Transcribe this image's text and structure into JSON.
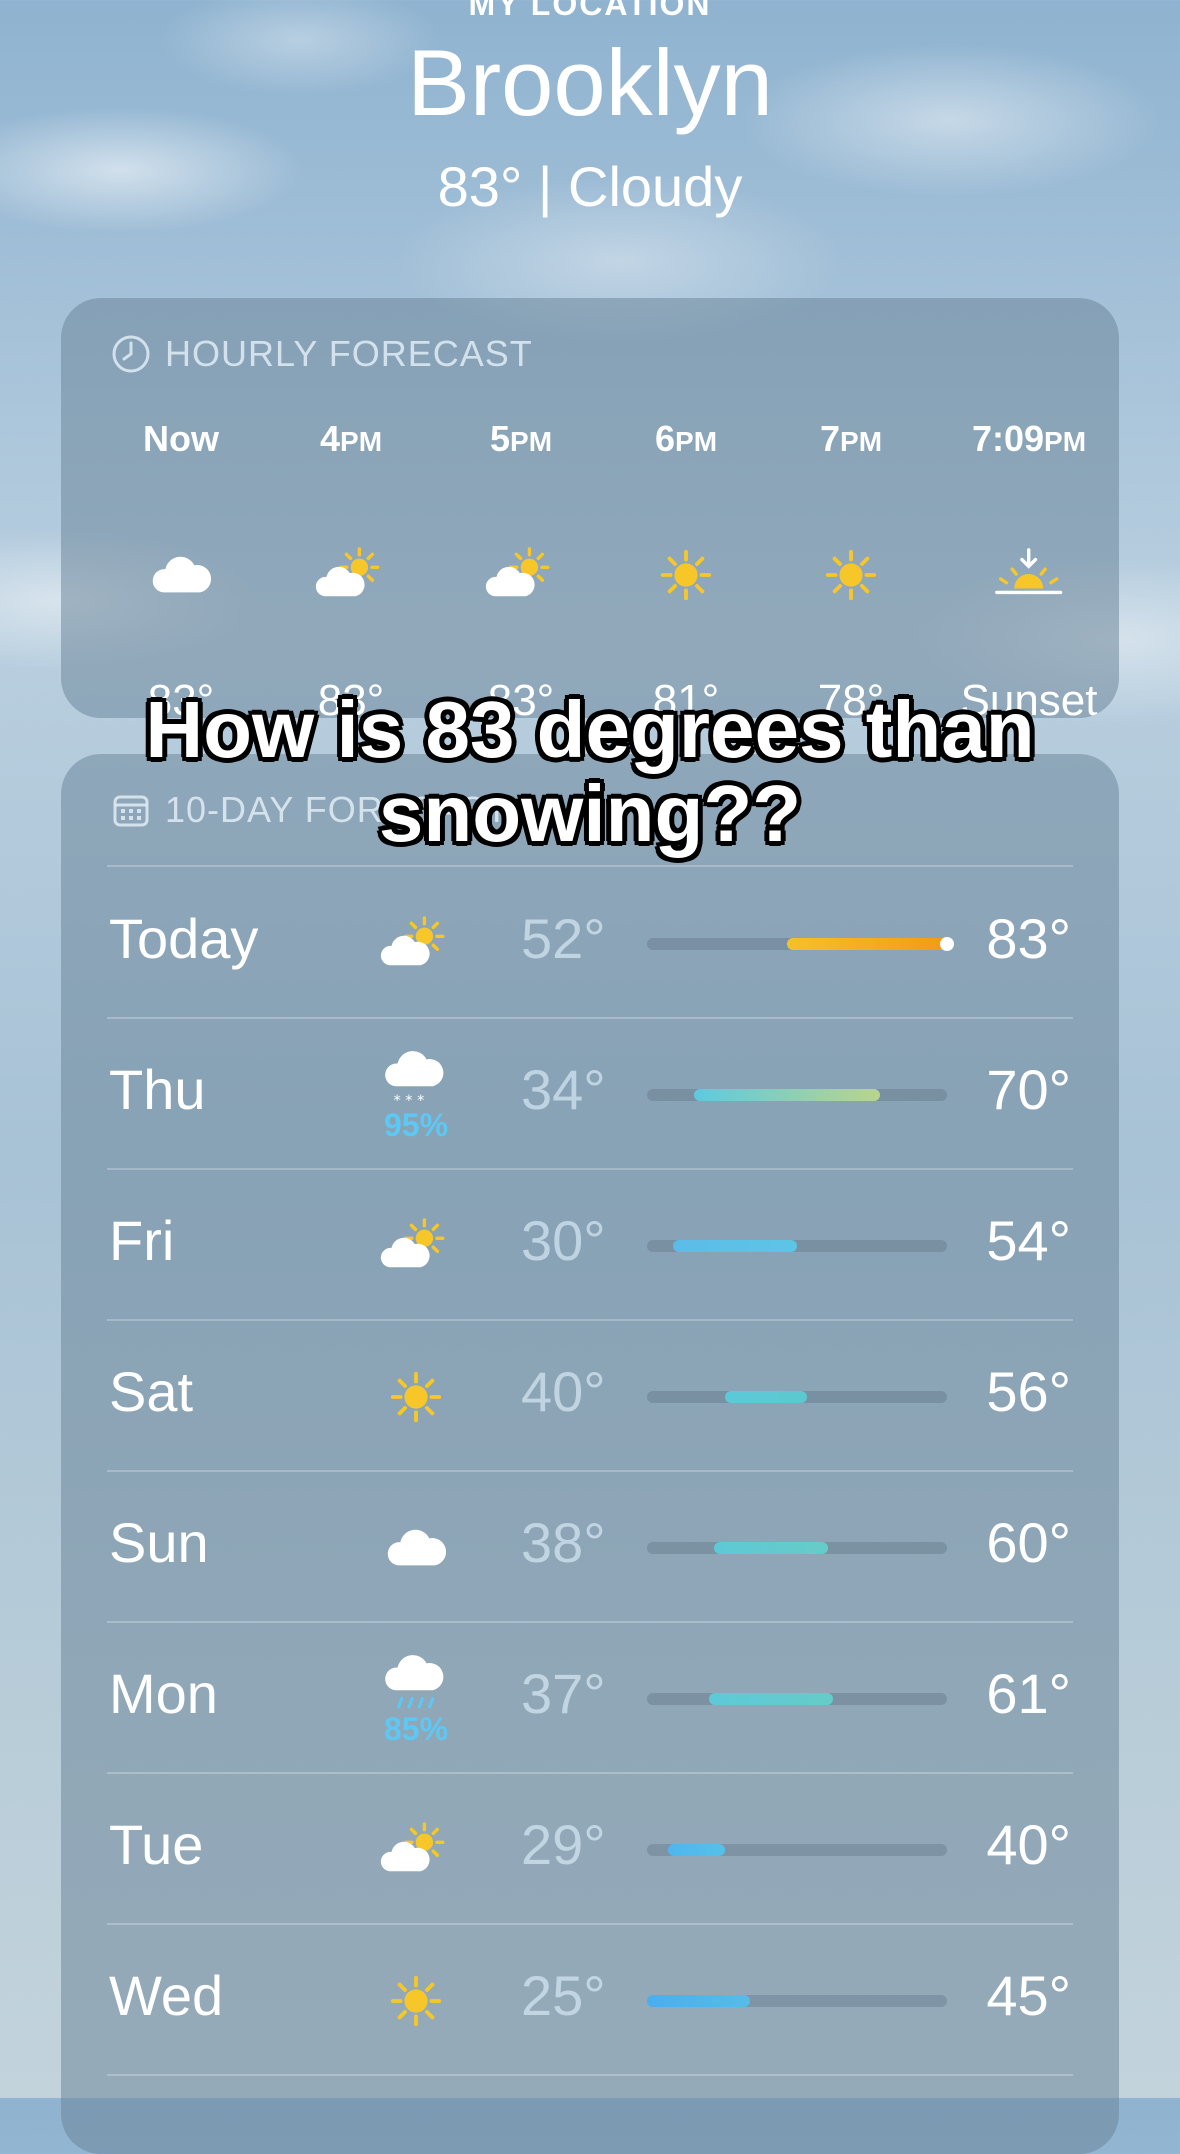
{
  "header": {
    "location_label": "MY LOCATION",
    "city": "Brooklyn",
    "summary": "83°  |  Cloudy"
  },
  "hourly": {
    "title": "HOURLY FORECAST",
    "title_icon": "clock-icon",
    "hours": [
      {
        "time": "Now",
        "suffix": "",
        "icon": "cloud-icon",
        "value": "83°"
      },
      {
        "time": "4",
        "suffix": "PM",
        "icon": "partly-sunny-icon",
        "value": "83°"
      },
      {
        "time": "5",
        "suffix": "PM",
        "icon": "partly-sunny-icon",
        "value": "83°"
      },
      {
        "time": "6",
        "suffix": "PM",
        "icon": "sun-icon",
        "value": "81°"
      },
      {
        "time": "7",
        "suffix": "PM",
        "icon": "sun-icon",
        "value": "78°"
      },
      {
        "time": "7:09",
        "suffix": "PM",
        "icon": "sunset-icon",
        "value": "Sunset"
      }
    ]
  },
  "daily": {
    "title": "10-DAY FORECAST",
    "title_icon": "calendar-icon",
    "range_min": 25,
    "range_max": 83,
    "days": [
      {
        "day": "Today",
        "icon": "partly-sunny-icon",
        "precip": "",
        "lo": "52°",
        "hi": "83°",
        "lo_val": 52,
        "hi_val": 83,
        "current": 83,
        "color_a": "#f6c02a",
        "color_b": "#f39a17"
      },
      {
        "day": "Thu",
        "icon": "snow-cloud-icon",
        "precip": "95%",
        "lo": "34°",
        "hi": "70°",
        "lo_val": 34,
        "hi_val": 70,
        "color_a": "#5ec9e0",
        "color_b": "#b9d48e"
      },
      {
        "day": "Fri",
        "icon": "partly-sunny-icon",
        "precip": "",
        "lo": "30°",
        "hi": "54°",
        "lo_val": 30,
        "hi_val": 54,
        "color_a": "#5bbce8",
        "color_b": "#5ec5e6"
      },
      {
        "day": "Sat",
        "icon": "sun-icon",
        "precip": "",
        "lo": "40°",
        "hi": "56°",
        "lo_val": 40,
        "hi_val": 56,
        "color_a": "#5cc9d8",
        "color_b": "#5cc9d0"
      },
      {
        "day": "Sun",
        "icon": "cloud-icon",
        "precip": "",
        "lo": "38°",
        "hi": "60°",
        "lo_val": 38,
        "hi_val": 60,
        "color_a": "#5ec9d6",
        "color_b": "#66ccc8"
      },
      {
        "day": "Mon",
        "icon": "rain-cloud-icon",
        "precip": "85%",
        "lo": "37°",
        "hi": "61°",
        "lo_val": 37,
        "hi_val": 61,
        "color_a": "#5ec9d8",
        "color_b": "#66ccc8"
      },
      {
        "day": "Tue",
        "icon": "partly-sunny-icon",
        "precip": "",
        "lo": "29°",
        "hi": "40°",
        "lo_val": 29,
        "hi_val": 40,
        "color_a": "#4fb6ee",
        "color_b": "#56c0e8"
      },
      {
        "day": "Wed",
        "icon": "sun-icon",
        "precip": "",
        "lo": "25°",
        "hi": "45°",
        "lo_val": 25,
        "hi_val": 45,
        "color_a": "#4aaef0",
        "color_b": "#54bde8"
      }
    ]
  },
  "caption": "How is 83 degrees than snowing??"
}
